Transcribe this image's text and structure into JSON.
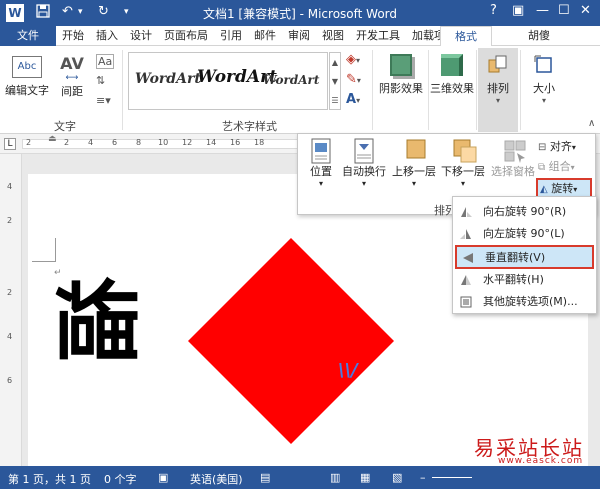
{
  "titlebar": {
    "title": "文档1 [兼容模式] - Microsoft Word",
    "help": "?",
    "restore": "▣",
    "minimize": "—",
    "maximize": "☐",
    "close": "✕"
  },
  "tabs": {
    "file": "文件",
    "home": "开始",
    "insert": "插入",
    "design": "设计",
    "layout": "页面布局",
    "references": "引用",
    "mailings": "邮件",
    "review": "审阅",
    "view": "视图",
    "developer": "开发工具",
    "addins": "加载项",
    "format": "格式",
    "user": "胡傻"
  },
  "ribbon": {
    "edit_text": "编辑文字",
    "spacing": "间距",
    "text_group": "文字",
    "wordart_group": "艺术字样式",
    "wordart_1": "WordArt",
    "wordart_2": "WordArt",
    "wordart_3": "WordArt",
    "shadow": "阴影效果",
    "threed": "三维效果",
    "arrange": "排列",
    "size": "大小",
    "edit_text_icon_letters": "Abc",
    "spacing_icon_letters": "AV",
    "aa_icon": "Aa"
  },
  "ruler": {
    "ticks": [
      "2",
      "2",
      "4",
      "6",
      "8",
      "10",
      "12",
      "14",
      "16",
      "18"
    ]
  },
  "vruler": {
    "ticks": [
      "4",
      "2",
      "2",
      "4",
      "6"
    ]
  },
  "arrange_popup": {
    "position": "位置",
    "wrap": "自动换行",
    "bring_forward": "上移一层",
    "send_backward": "下移一层",
    "selection_pane": "选择窗格",
    "align": "对齐",
    "group": "组合",
    "rotate": "旋转",
    "group_label": "排列"
  },
  "rotate_menu": {
    "items": [
      {
        "label": "向右旋转 90°(R)"
      },
      {
        "label": "向左旋转 90°(L)"
      },
      {
        "label": "垂直翻转(V)"
      },
      {
        "label": "水平翻转(H)"
      },
      {
        "label": "其他旋转选项(M)..."
      }
    ]
  },
  "document": {
    "glyph": "福",
    "paragraph_mark": "↵"
  },
  "statusbar": {
    "page": "第 1 页，共 1 页",
    "words": "0 个字",
    "lang": "英语(美国)"
  },
  "watermark": {
    "text": "易采站长站",
    "url": "www.easck.com"
  },
  "colors": {
    "accent": "#2b579a",
    "highlight_box": "#d83b2c",
    "diamond": "#ff0000",
    "hover": "#cde6f7"
  }
}
